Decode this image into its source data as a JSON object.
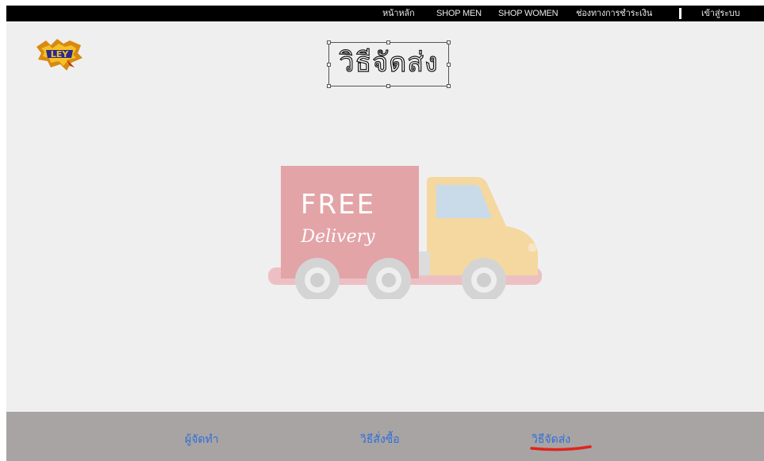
{
  "nav": {
    "home": "หน้าหลัก",
    "shop_men": "SHOP MEN",
    "shop_women": "SHOP WOMEN",
    "payment": "ช่องทางการชำระเงิน",
    "login": "เข้าสู่ระบบ"
  },
  "brand": {
    "logo_text": "LEY"
  },
  "page": {
    "title": "วิธีจัดส่ง"
  },
  "banner": {
    "line1": "FREE",
    "line2": "Delivery"
  },
  "footer": {
    "links": [
      {
        "label": "ผู้จัดทำ"
      },
      {
        "label": "วิธีสั่งซื้อ"
      },
      {
        "label": "วิธีจัดส่ง",
        "active": true
      }
    ]
  },
  "colors": {
    "nav_bg": "#000000",
    "page_bg": "#f0eff0",
    "footer_bg": "#a8a4a4",
    "link": "#2f6fd6",
    "active_underline": "#e0241c",
    "truck_box": "#e6a9ad",
    "truck_cab": "#f3d9a2"
  }
}
